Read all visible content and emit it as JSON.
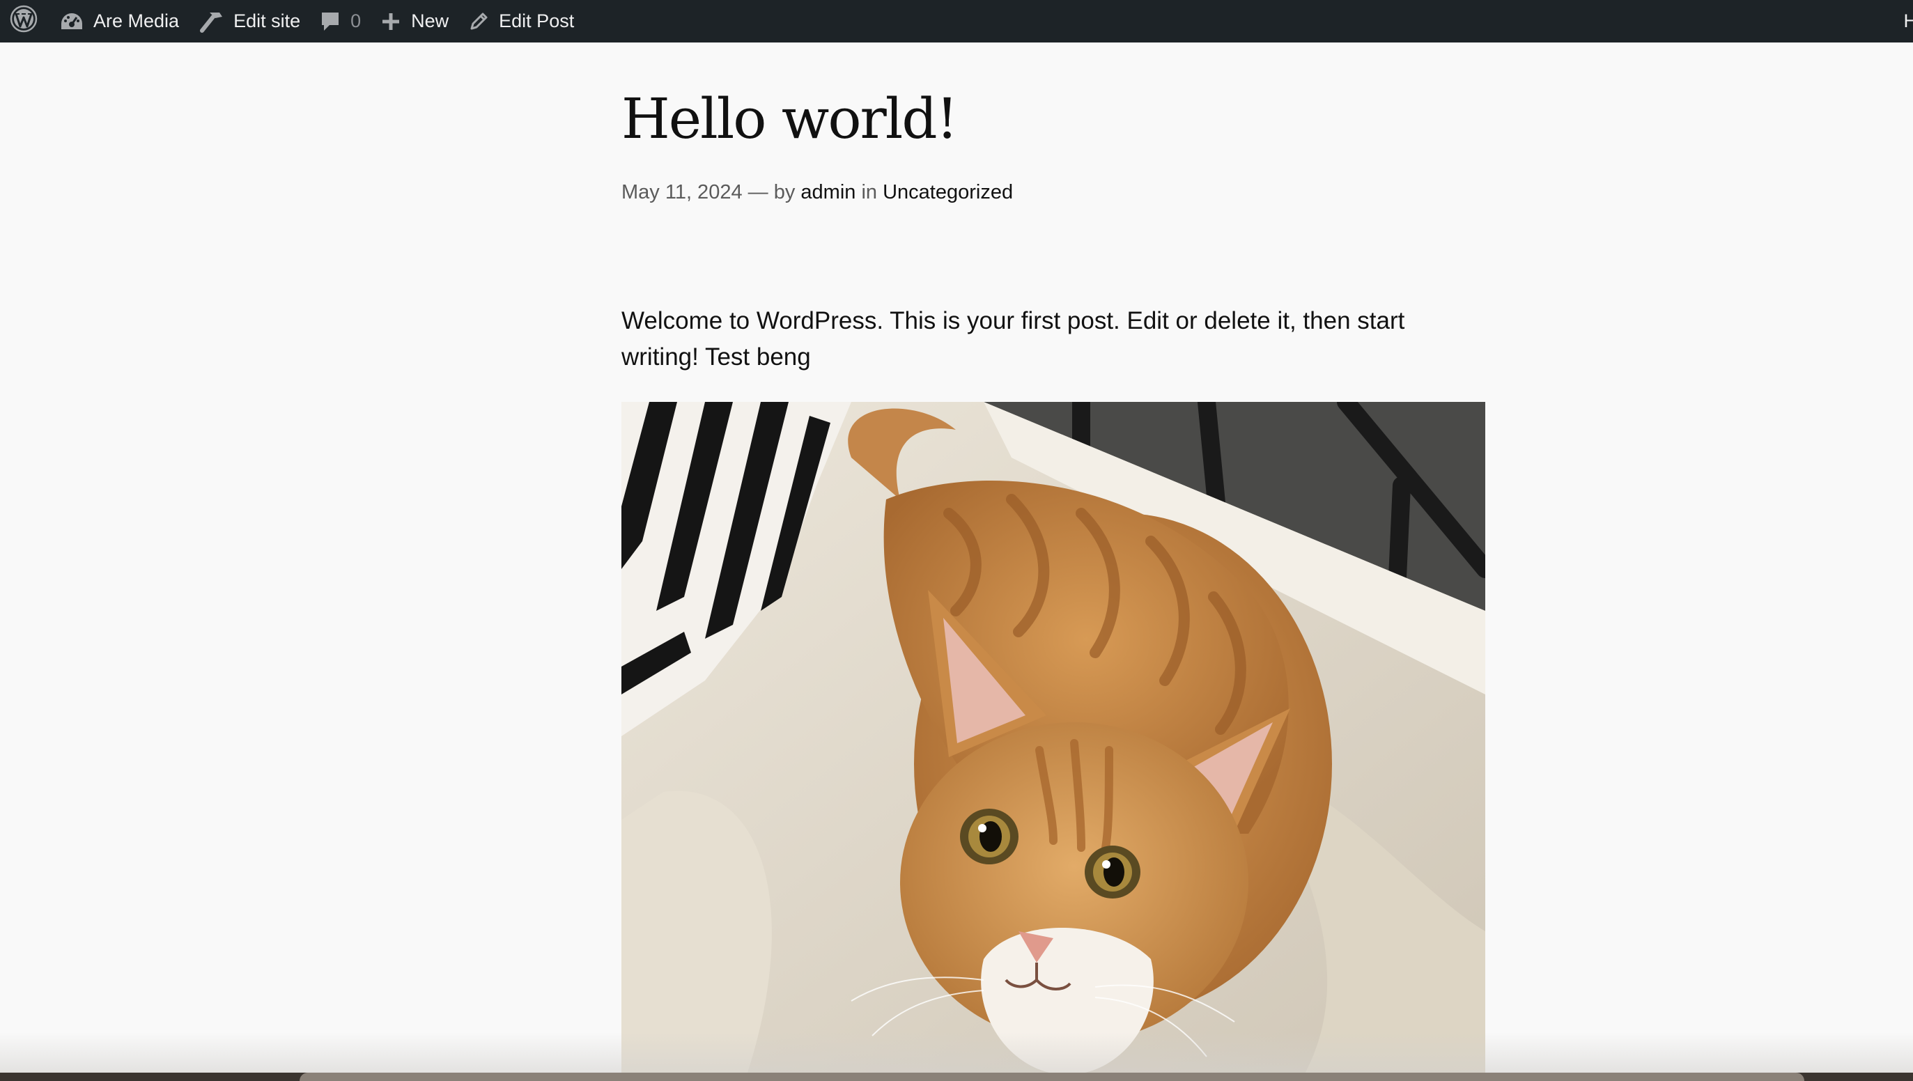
{
  "adminbar": {
    "site_name": "Are Media",
    "edit_site": "Edit site",
    "comments_count": "0",
    "new_label": "New",
    "edit_post": "Edit Post",
    "howdy_partial": "H"
  },
  "post": {
    "title": "Hello world!",
    "date": "May 11, 2024",
    "separator": "—",
    "by": "by",
    "author": "admin",
    "in": "in",
    "category": "Uncategorized",
    "body": "Welcome to WordPress. This is your first post. Edit or delete it, then start writing! Test beng"
  },
  "colors": {
    "adminbar_bg": "#1d2327",
    "page_bg": "#f9f9f9",
    "text": "#111111",
    "meta_text": "#5b5b5b"
  },
  "icons": {
    "wp_logo": "wordpress-logo-icon",
    "dashboard": "dashboard-icon",
    "edit_site": "hammer-icon",
    "comments": "comment-bubble-icon",
    "new": "plus-icon",
    "edit_post": "pencil-icon"
  }
}
